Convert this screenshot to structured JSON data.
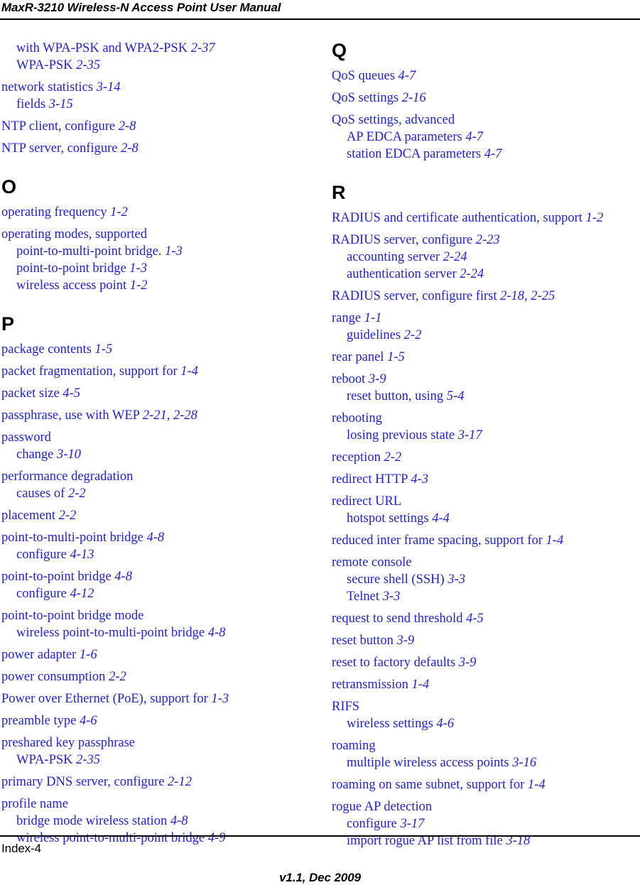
{
  "header": {
    "title": "MaxR-3210 Wireless-N Access Point User Manual"
  },
  "footer": {
    "page_label": "Index-4",
    "version": "v1.1, Dec 2009"
  },
  "colors": {
    "entry_blue": "#2222cc",
    "text_black": "#000000",
    "page_background": "#ffffff"
  },
  "index": {
    "columns": [
      {
        "id": "left",
        "blocks": [
          {
            "type": "group",
            "after_letter": false,
            "lines": [
              {
                "level": 1,
                "text": "with WPA-PSK and WPA2-PSK ",
                "page": "2-37"
              },
              {
                "level": 1,
                "text": "WPA-PSK ",
                "page": "2-35"
              }
            ]
          },
          {
            "type": "group",
            "after_letter": false,
            "lines": [
              {
                "level": 0,
                "text": "network statistics ",
                "page": "3-14"
              },
              {
                "level": 1,
                "text": "fields ",
                "page": "3-15"
              }
            ]
          },
          {
            "type": "group",
            "after_letter": false,
            "lines": [
              {
                "level": 0,
                "text": "NTP client, configure ",
                "page": "2-8"
              }
            ]
          },
          {
            "type": "group",
            "after_letter": false,
            "lines": [
              {
                "level": 0,
                "text": "NTP server, configure ",
                "page": "2-8"
              }
            ]
          },
          {
            "type": "letter",
            "letter": "O",
            "spaced_above": true
          },
          {
            "type": "group",
            "after_letter": true,
            "lines": [
              {
                "level": 0,
                "text": "operating frequency ",
                "page": "1-2"
              }
            ]
          },
          {
            "type": "group",
            "after_letter": false,
            "lines": [
              {
                "level": 0,
                "text": "operating modes, supported",
                "page": ""
              },
              {
                "level": 1,
                "text": "point-to-multi-point bridge. ",
                "page": "1-3"
              },
              {
                "level": 1,
                "text": "point-to-point bridge ",
                "page": "1-3"
              },
              {
                "level": 1,
                "text": "wireless access point ",
                "page": "1-2"
              }
            ]
          },
          {
            "type": "letter",
            "letter": "P",
            "spaced_above": true
          },
          {
            "type": "group",
            "after_letter": true,
            "lines": [
              {
                "level": 0,
                "text": "package contents ",
                "page": "1-5"
              }
            ]
          },
          {
            "type": "group",
            "after_letter": false,
            "lines": [
              {
                "level": 0,
                "text": "packet fragmentation, support for ",
                "page": "1-4"
              }
            ]
          },
          {
            "type": "group",
            "after_letter": false,
            "lines": [
              {
                "level": 0,
                "text": "packet size ",
                "page": "4-5"
              }
            ]
          },
          {
            "type": "group",
            "after_letter": false,
            "lines": [
              {
                "level": 0,
                "text": "passphrase, use with WEP ",
                "page": "2-21, 2-28"
              }
            ]
          },
          {
            "type": "group",
            "after_letter": false,
            "lines": [
              {
                "level": 0,
                "text": "password",
                "page": ""
              },
              {
                "level": 1,
                "text": "change ",
                "page": "3-10"
              }
            ]
          },
          {
            "type": "group",
            "after_letter": false,
            "lines": [
              {
                "level": 0,
                "text": "performance degradation",
                "page": ""
              },
              {
                "level": 1,
                "text": "causes of ",
                "page": "2-2"
              }
            ]
          },
          {
            "type": "group",
            "after_letter": false,
            "lines": [
              {
                "level": 0,
                "text": "placement ",
                "page": "2-2"
              }
            ]
          },
          {
            "type": "group",
            "after_letter": false,
            "lines": [
              {
                "level": 0,
                "text": "point-to-multi-point bridge ",
                "page": "4-8"
              },
              {
                "level": 1,
                "text": "configure ",
                "page": "4-13"
              }
            ]
          },
          {
            "type": "group",
            "after_letter": false,
            "lines": [
              {
                "level": 0,
                "text": "point-to-point bridge ",
                "page": "4-8"
              },
              {
                "level": 1,
                "text": "configure ",
                "page": "4-12"
              }
            ]
          },
          {
            "type": "group",
            "after_letter": false,
            "lines": [
              {
                "level": 0,
                "text": "point-to-point bridge mode",
                "page": ""
              },
              {
                "level": 1,
                "text": "wireless point-to-multi-point bridge ",
                "page": "4-8"
              }
            ]
          },
          {
            "type": "group",
            "after_letter": false,
            "lines": [
              {
                "level": 0,
                "text": "power adapter ",
                "page": "1-6"
              }
            ]
          },
          {
            "type": "group",
            "after_letter": false,
            "lines": [
              {
                "level": 0,
                "text": "power consumption ",
                "page": "2-2"
              }
            ]
          },
          {
            "type": "group",
            "after_letter": false,
            "lines": [
              {
                "level": 0,
                "text": "Power over Ethernet (PoE), support for ",
                "page": "1-3"
              }
            ]
          },
          {
            "type": "group",
            "after_letter": false,
            "lines": [
              {
                "level": 0,
                "text": "preamble type ",
                "page": "4-6"
              }
            ]
          },
          {
            "type": "group",
            "after_letter": false,
            "lines": [
              {
                "level": 0,
                "text": "preshared key passphrase",
                "page": ""
              },
              {
                "level": 1,
                "text": "WPA-PSK ",
                "page": "2-35"
              }
            ]
          },
          {
            "type": "group",
            "after_letter": false,
            "lines": [
              {
                "level": 0,
                "text": "primary DNS server, configure ",
                "page": "2-12"
              }
            ]
          },
          {
            "type": "group",
            "after_letter": false,
            "lines": [
              {
                "level": 0,
                "text": "profile name",
                "page": ""
              },
              {
                "level": 1,
                "text": "bridge mode wireless station ",
                "page": "4-8"
              },
              {
                "level": 1,
                "text": "wireless point-to-multi-point bridge ",
                "page": "4-9"
              }
            ]
          }
        ]
      },
      {
        "id": "right",
        "blocks": [
          {
            "type": "letter",
            "letter": "Q",
            "spaced_above": false
          },
          {
            "type": "group",
            "after_letter": true,
            "lines": [
              {
                "level": 0,
                "text": "QoS queues ",
                "page": "4-7"
              }
            ]
          },
          {
            "type": "group",
            "after_letter": false,
            "lines": [
              {
                "level": 0,
                "text": "QoS settings ",
                "page": "2-16"
              }
            ]
          },
          {
            "type": "group",
            "after_letter": false,
            "lines": [
              {
                "level": 0,
                "text": "QoS settings, advanced",
                "page": ""
              },
              {
                "level": 1,
                "text": "AP EDCA parameters ",
                "page": "4-7"
              },
              {
                "level": 1,
                "text": "station EDCA parameters ",
                "page": "4-7"
              }
            ]
          },
          {
            "type": "letter",
            "letter": "R",
            "spaced_above": true
          },
          {
            "type": "group",
            "after_letter": true,
            "lines": [
              {
                "level": 0,
                "text": "RADIUS and certificate authentication, support ",
                "page": "1-2"
              }
            ]
          },
          {
            "type": "group",
            "after_letter": false,
            "lines": [
              {
                "level": 0,
                "text": "RADIUS server, configure ",
                "page": "2-23"
              },
              {
                "level": 1,
                "text": "accounting server ",
                "page": "2-24"
              },
              {
                "level": 1,
                "text": "authentication server ",
                "page": "2-24"
              }
            ]
          },
          {
            "type": "group",
            "after_letter": false,
            "lines": [
              {
                "level": 0,
                "text": "RADIUS server, configure first ",
                "page": "2-18, 2-25"
              }
            ]
          },
          {
            "type": "group",
            "after_letter": false,
            "lines": [
              {
                "level": 0,
                "text": "range ",
                "page": "1-1"
              },
              {
                "level": 1,
                "text": "guidelines ",
                "page": "2-2"
              }
            ]
          },
          {
            "type": "group",
            "after_letter": false,
            "lines": [
              {
                "level": 0,
                "text": "rear panel ",
                "page": "1-5"
              }
            ]
          },
          {
            "type": "group",
            "after_letter": false,
            "lines": [
              {
                "level": 0,
                "text": "reboot ",
                "page": "3-9"
              },
              {
                "level": 1,
                "text": "reset button, using ",
                "page": "5-4"
              }
            ]
          },
          {
            "type": "group",
            "after_letter": false,
            "lines": [
              {
                "level": 0,
                "text": "rebooting",
                "page": ""
              },
              {
                "level": 1,
                "text": "losing previous state ",
                "page": "3-17"
              }
            ]
          },
          {
            "type": "group",
            "after_letter": false,
            "lines": [
              {
                "level": 0,
                "text": "reception ",
                "page": "2-2"
              }
            ]
          },
          {
            "type": "group",
            "after_letter": false,
            "lines": [
              {
                "level": 0,
                "text": "redirect HTTP ",
                "page": "4-3"
              }
            ]
          },
          {
            "type": "group",
            "after_letter": false,
            "lines": [
              {
                "level": 0,
                "text": "redirect URL",
                "page": ""
              },
              {
                "level": 1,
                "text": "hotspot settings ",
                "page": "4-4"
              }
            ]
          },
          {
            "type": "group",
            "after_letter": false,
            "lines": [
              {
                "level": 0,
                "text": "reduced inter frame spacing, support for ",
                "page": "1-4"
              }
            ]
          },
          {
            "type": "group",
            "after_letter": false,
            "lines": [
              {
                "level": 0,
                "text": "remote console",
                "page": ""
              },
              {
                "level": 1,
                "text": "secure shell (SSH) ",
                "page": "3-3"
              },
              {
                "level": 1,
                "text": "Telnet ",
                "page": "3-3"
              }
            ]
          },
          {
            "type": "group",
            "after_letter": false,
            "lines": [
              {
                "level": 0,
                "text": "request to send threshold ",
                "page": "4-5"
              }
            ]
          },
          {
            "type": "group",
            "after_letter": false,
            "lines": [
              {
                "level": 0,
                "text": "reset button ",
                "page": "3-9"
              }
            ]
          },
          {
            "type": "group",
            "after_letter": false,
            "lines": [
              {
                "level": 0,
                "text": "reset to factory defaults ",
                "page": "3-9"
              }
            ]
          },
          {
            "type": "group",
            "after_letter": false,
            "lines": [
              {
                "level": 0,
                "text": "retransmission ",
                "page": "1-4"
              }
            ]
          },
          {
            "type": "group",
            "after_letter": false,
            "lines": [
              {
                "level": 0,
                "text": "RIFS",
                "page": ""
              },
              {
                "level": 1,
                "text": "wireless settings ",
                "page": "4-6"
              }
            ]
          },
          {
            "type": "group",
            "after_letter": false,
            "lines": [
              {
                "level": 0,
                "text": "roaming",
                "page": ""
              },
              {
                "level": 1,
                "text": "multiple wireless access points ",
                "page": "3-16"
              }
            ]
          },
          {
            "type": "group",
            "after_letter": false,
            "lines": [
              {
                "level": 0,
                "text": "roaming on same subnet, support for ",
                "page": "1-4"
              }
            ]
          },
          {
            "type": "group",
            "after_letter": false,
            "lines": [
              {
                "level": 0,
                "text": "rogue AP detection",
                "page": ""
              },
              {
                "level": 1,
                "text": "configure ",
                "page": "3-17"
              },
              {
                "level": 1,
                "text": "import rogue AP list from file ",
                "page": "3-18"
              }
            ]
          }
        ]
      }
    ]
  }
}
